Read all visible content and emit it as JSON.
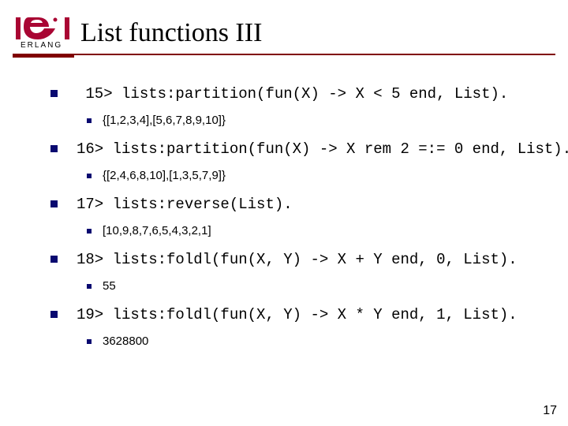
{
  "logo": {
    "alt": "Erlang",
    "main_color": "#a90533",
    "text": "ERLANG"
  },
  "title": "List functions III",
  "items": [
    {
      "code": " 15> lists:partition(fun(X) -> X < 5 end, List).",
      "result": "{[1,2,3,4],[5,6,7,8,9,10]}"
    },
    {
      "code": "16> lists:partition(fun(X) -> X rem 2 =:= 0 end, List).",
      "result": "{[2,4,6,8,10],[1,3,5,7,9]}"
    },
    {
      "code": "17> lists:reverse(List).",
      "result": "[10,9,8,7,6,5,4,3,2,1]"
    },
    {
      "code": "18> lists:foldl(fun(X, Y) -> X + Y end, 0, List).",
      "result": "55"
    },
    {
      "code": "19> lists:foldl(fun(X, Y) -> X * Y end, 1, List).",
      "result": "3628800"
    }
  ],
  "page_number": "17"
}
